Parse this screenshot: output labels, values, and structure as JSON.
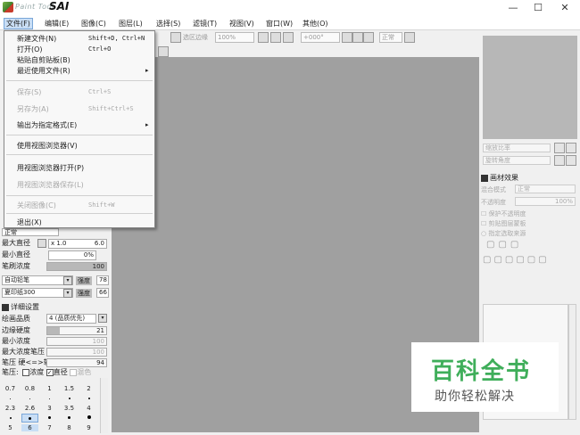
{
  "window": {
    "app_name_small": "Paint Tool",
    "app_name_large": "SAI",
    "minimize": "—",
    "maximize": "☐",
    "close": "✕"
  },
  "menubar": {
    "items": [
      {
        "label": "文件(F)"
      },
      {
        "label": "编辑(E)"
      },
      {
        "label": "图像(C)"
      },
      {
        "label": "图层(L)"
      },
      {
        "label": "选择(S)"
      },
      {
        "label": "滤镜(T)"
      },
      {
        "label": "视图(V)"
      },
      {
        "label": "窗口(W)"
      },
      {
        "label": "其他(O)"
      }
    ]
  },
  "toolbar": {
    "selection_edge": "选区边缘",
    "zoom": "100%",
    "angle": "+000°",
    "mode": "正常"
  },
  "file_menu": {
    "items": [
      {
        "label": "新建文件(N)",
        "shortcut": "Shift+D, Ctrl+N"
      },
      {
        "label": "打开(O)",
        "shortcut": "Ctrl+O"
      },
      {
        "label": "粘贴自剪贴板(B)",
        "shortcut": ""
      },
      {
        "label": "最近使用文件(R)",
        "shortcut": "",
        "arrow": "▸"
      },
      {
        "label": "保存(S)",
        "shortcut": "Ctrl+S"
      },
      {
        "label": "另存为(A)",
        "shortcut": "Shift+Ctrl+S"
      },
      {
        "label": "输出为指定格式(E)",
        "shortcut": "",
        "arrow": "▸"
      },
      {
        "label": "使用视图浏览器(V)",
        "shortcut": ""
      },
      {
        "label": "用视图浏览器打开(P)",
        "shortcut": ""
      },
      {
        "label": "用视图浏览器保存(L)",
        "shortcut": ""
      },
      {
        "label": "关闭图像(C)",
        "shortcut": "Shift+W"
      },
      {
        "label": "退出(X)",
        "shortcut": ""
      }
    ]
  },
  "tool_panel": {
    "blend_mode": "正常",
    "max_size_label": "最大直径",
    "max_size_multiplier": "x 1.0",
    "max_size_value": "6.0",
    "min_size_label": "最小直径",
    "min_size_value": "0%",
    "brush_density_label": "笔刷浓度",
    "brush_density_value": "100",
    "brush_density_fill": 1.0,
    "shape_select": "自动铅笔",
    "shape_strength_label": "强度",
    "shape_strength_value": "78",
    "texture_select": "夏印纸300",
    "texture_strength_label": "强度",
    "texture_strength_value": "66",
    "advanced_label": "详细设置",
    "quality_label": "绘画品质",
    "quality_value": "4 (品质优先)",
    "edge_hardness_label": "边缘硬度",
    "edge_hardness_value": "21",
    "edge_hardness_fill": 0.21,
    "min_density_label": "最小浓度",
    "min_density_value": "100",
    "max_density_pressure_label": "最大浓度笔压",
    "max_density_pressure_value": "100",
    "pressure_hard_soft_label": "笔压 硬<=>软",
    "pressure_hard_soft_value": "94",
    "pressure_label": "笔压:",
    "pressure_density_label": "浓度",
    "pressure_size_label": "直径",
    "pressure_blend_label": "混色",
    "size_presets": [
      [
        "0.7",
        "0.8",
        "1",
        "1.5",
        "2"
      ],
      [
        "2.3",
        "2.6",
        "3",
        "3.5",
        "4"
      ],
      [
        "5",
        "6",
        "7",
        "8",
        "9"
      ]
    ]
  },
  "right_panel": {
    "zoom_label": "缩放比率",
    "rotate_label": "旋转角度",
    "layer_effect_label": "画材效果",
    "blend_label": "混合模式",
    "blend_value": "正常",
    "opacity_label": "不透明度",
    "opacity_value": "100%",
    "protect_opacity": "保护不透明度",
    "clip_group": "剪贴图层蒙板",
    "select_source": "指定选取来源"
  },
  "watermark": {
    "main": "百科全书",
    "sub": "助你轻松解决"
  }
}
